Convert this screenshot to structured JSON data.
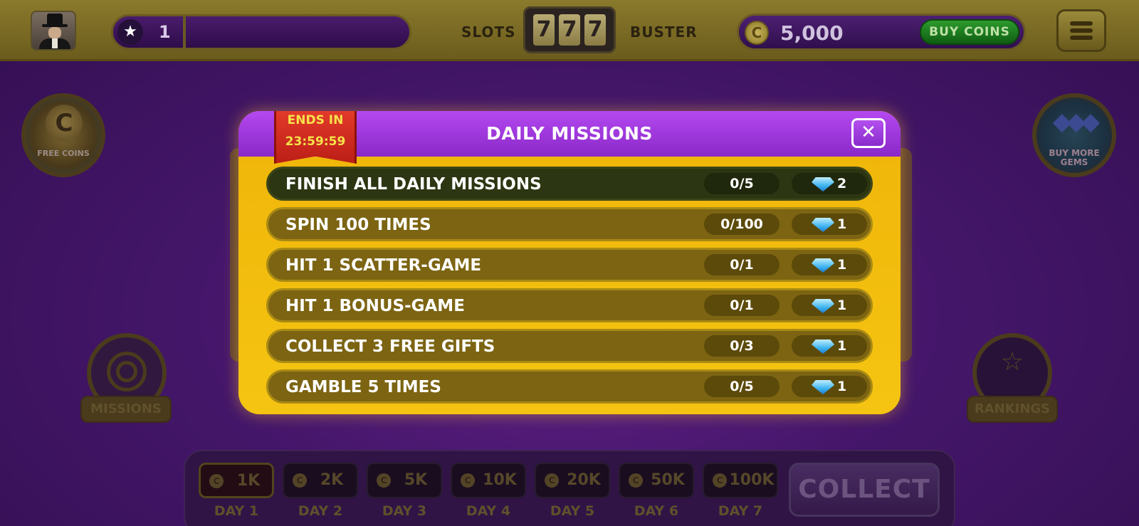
{
  "topbar": {
    "level": "1",
    "logo_left": "SLOTS",
    "logo_reels": [
      "7",
      "7",
      "7"
    ],
    "logo_right": "BUSTER",
    "coins": "5,000",
    "buy_coins_label": "BUY COINS",
    "coin_symbol": "C"
  },
  "side": {
    "free_coins_label": "FREE COINS",
    "buy_gems_label": "BUY MORE GEMS",
    "missions_label": "MISSIONS",
    "rankings_label": "RANKINGS"
  },
  "modal": {
    "title": "DAILY MISSIONS",
    "ribbon_line1": "ENDS IN",
    "ribbon_line2": "23:59:59",
    "close_symbol": "✕",
    "missions": [
      {
        "label": "FINISH ALL DAILY MISSIONS",
        "progress": "0/5",
        "reward": "2"
      },
      {
        "label": "SPIN 100 TIMES",
        "progress": "0/100",
        "reward": "1"
      },
      {
        "label": "HIT 1 SCATTER-GAME",
        "progress": "0/1",
        "reward": "1"
      },
      {
        "label": "HIT 1 BONUS-GAME",
        "progress": "0/1",
        "reward": "1"
      },
      {
        "label": "COLLECT 3 FREE GIFTS",
        "progress": "0/3",
        "reward": "1"
      },
      {
        "label": "GAMBLE 5 TIMES",
        "progress": "0/5",
        "reward": "1"
      }
    ]
  },
  "bonus": {
    "days": [
      {
        "amount": "1K",
        "label": "DAY 1"
      },
      {
        "amount": "2K",
        "label": "DAY 2"
      },
      {
        "amount": "5K",
        "label": "DAY 3"
      },
      {
        "amount": "10K",
        "label": "DAY 4"
      },
      {
        "amount": "20K",
        "label": "DAY 5"
      },
      {
        "amount": "50K",
        "label": "DAY 6"
      },
      {
        "amount": "100K",
        "label": "DAY 7"
      }
    ],
    "collect_label": "COLLECT"
  },
  "colors": {
    "modal_header": "#9b35dc",
    "modal_body": "#f1bc0c",
    "row_bg": "#7c6412",
    "first_row_bg": "#2c3612",
    "ribbon": "#d22b1f",
    "ribbon_text": "#f5e24a",
    "buy_coins_button": "#1f7d20"
  },
  "icons": {
    "level": "star-icon",
    "coin": "coin-icon",
    "menu": "hamburger-menu-icon",
    "reward": "gem-icon",
    "close": "close-icon",
    "missions": "target-icon",
    "rankings": "podium-star-icon"
  }
}
